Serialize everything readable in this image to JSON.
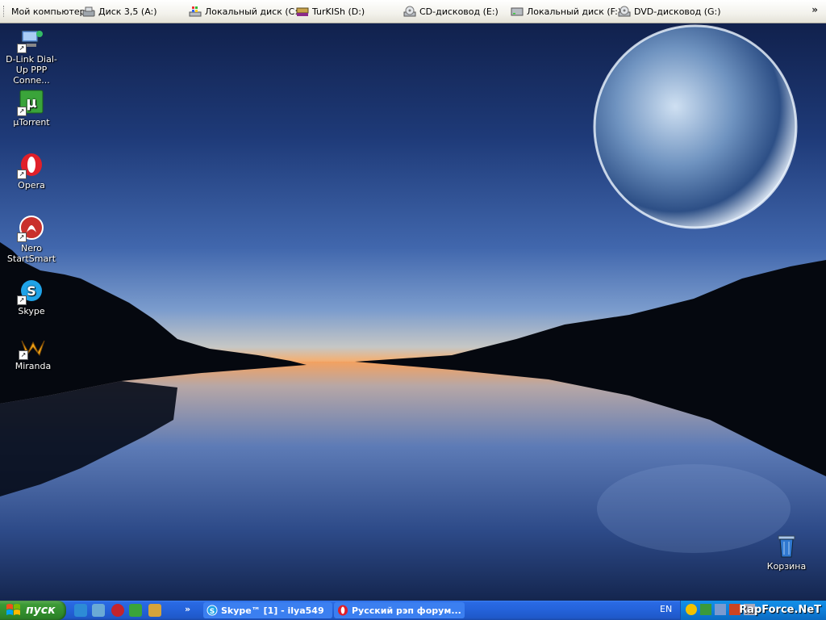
{
  "topbar": {
    "drives": [
      {
        "label": "Мой компьютер",
        "icon": "computer-icon"
      },
      {
        "label": "Диск 3,5 (A:)",
        "icon": "floppy-icon"
      },
      {
        "label": "Локальный диск (C:)",
        "icon": "windows-drive-icon"
      },
      {
        "label": "TurKISh (D:)",
        "icon": "shared-drive-icon"
      },
      {
        "label": "CD-дисковод (E:)",
        "icon": "cd-drive-icon"
      },
      {
        "label": "Локальный диск (F:)",
        "icon": "hard-drive-icon"
      },
      {
        "label": "DVD-дисковод (G:)",
        "icon": "dvd-drive-icon"
      }
    ],
    "more": "»"
  },
  "desktop_icons": [
    {
      "label": "D-Link Dial-Up PPP Conne...",
      "icon": "network-connection-icon"
    },
    {
      "label": "µTorrent",
      "icon": "utorrent-icon"
    },
    {
      "label": "Opera",
      "icon": "opera-icon"
    },
    {
      "label": "Nero StartSmart",
      "icon": "nero-icon"
    },
    {
      "label": "Skype",
      "icon": "skype-icon"
    },
    {
      "label": "Miranda",
      "icon": "miranda-icon"
    },
    {
      "label": "Корзина",
      "icon": "recycle-bin-icon"
    }
  ],
  "taskbar": {
    "start_label": "пуск",
    "quicklaunch_more": "»",
    "tasks": [
      {
        "label": "Skype™ [1] - ilya549",
        "icon": "skype-icon"
      },
      {
        "label": "Русский рэп форум...",
        "icon": "opera-icon"
      }
    ],
    "language": "EN"
  },
  "watermark": "RapForce.NeT",
  "colors": {
    "taskbar": "#2462d9",
    "start": "#3c9a36",
    "tray": "#0f7fda"
  }
}
